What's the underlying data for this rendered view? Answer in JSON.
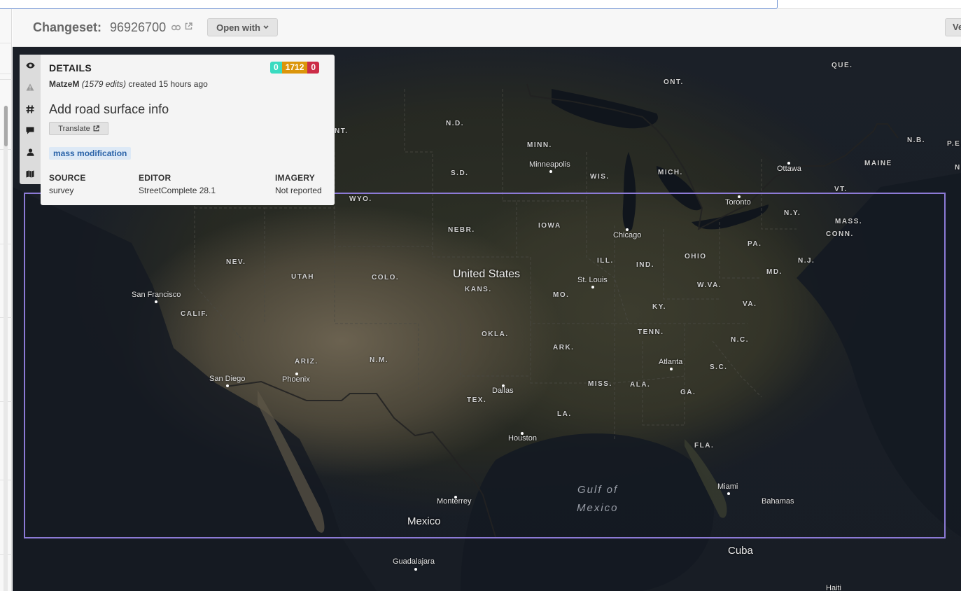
{
  "header": {
    "changeset_label": "Changeset:",
    "changeset_id": "96926700",
    "open_with_label": "Open with",
    "view_label": "Ve"
  },
  "details": {
    "title": "DETAILS",
    "counts": {
      "create": "0",
      "modify": "1712",
      "delete": "0"
    },
    "user": "MatzeM",
    "edits": "(1579 edits)",
    "created": "created 15 hours ago",
    "comment": "Add road surface info",
    "translate_label": "Translate",
    "hashtag": "mass modification",
    "source_label": "SOURCE",
    "source_value": "survey",
    "editor_label": "EDITOR",
    "editor_value": "StreetComplete 28.1",
    "imagery_label": "IMAGERY",
    "imagery_value": "Not reported"
  },
  "tabs": [
    "eye-icon",
    "warning-icon",
    "hashtag-icon",
    "comment-icon",
    "user-icon",
    "map-icon"
  ],
  "colors": {
    "create": "#39dbc0",
    "modify": "#db950a",
    "delete": "#cc2c47",
    "bbox": "#8c7ad6"
  },
  "map": {
    "states": [
      "QUE.",
      "ONT.",
      "N.D.",
      "MINN.",
      "N.B.",
      "P.E.",
      "MAINE",
      "S.D.",
      "WIS.",
      "MICH.",
      "N.",
      "VT.",
      "WYO.",
      "NEBR.",
      "IOWA",
      "N.Y.",
      "MASS.",
      "CONN.",
      "PA.",
      "NEV.",
      "UTAH",
      "COLO.",
      "KANS.",
      "ILL.",
      "IND.",
      "OHIO",
      "N.J.",
      "MD.",
      "W.VA.",
      "MO.",
      "KY.",
      "VA.",
      "CALIF.",
      "TENN.",
      "N.C.",
      "OKLA.",
      "ARK.",
      "ARIZ.",
      "N.M.",
      "S.C.",
      "MISS.",
      "ALA.",
      "GA.",
      "TEX.",
      "LA.",
      "FLA.",
      "NT."
    ],
    "cities": [
      "Minneapolis",
      "Ottawa",
      "Toronto",
      "Chicago",
      "St. Louis",
      "San Francisco",
      "Atlanta",
      "San Diego",
      "Phoenix",
      "Dallas",
      "Houston",
      "Miami",
      "Monterrey",
      "Guadalajara",
      "Bahamas",
      "Haiti"
    ],
    "countries": [
      "United States",
      "Mexico",
      "Cuba"
    ],
    "water": [
      "Gulf of",
      "Mexico"
    ]
  }
}
